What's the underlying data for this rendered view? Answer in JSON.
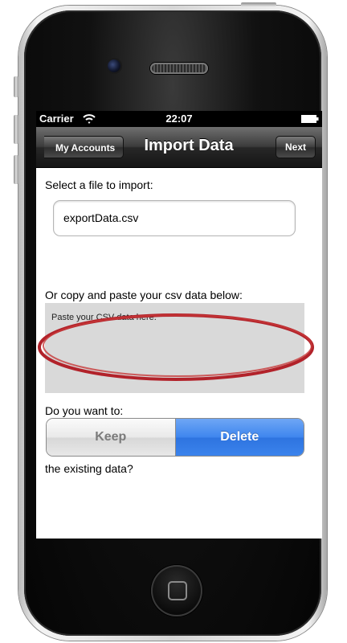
{
  "status_bar": {
    "carrier": "Carrier",
    "time": "22:07"
  },
  "nav_bar": {
    "back_label": "My Accounts",
    "title": "Import Data",
    "next_label": "Next"
  },
  "form": {
    "select_file_label": "Select a file to import:",
    "file_name": "exportData.csv",
    "paste_label": "Or copy and paste your csv data below:",
    "csv_placeholder": "Paste your CSV data here.",
    "choice_label": "Do you want to:",
    "segments": [
      "Keep",
      "Delete"
    ],
    "selected_segment": "Delete",
    "existing_data_label": "the existing data?"
  },
  "colors": {
    "selected_segment": "#3f86ee",
    "highlight_ellipse": "#b2222a",
    "csv_area": "#d9d9d9"
  },
  "icons": [
    "wifi-icon",
    "battery-icon",
    "back-arrow-icon",
    "home-button-icon"
  ]
}
